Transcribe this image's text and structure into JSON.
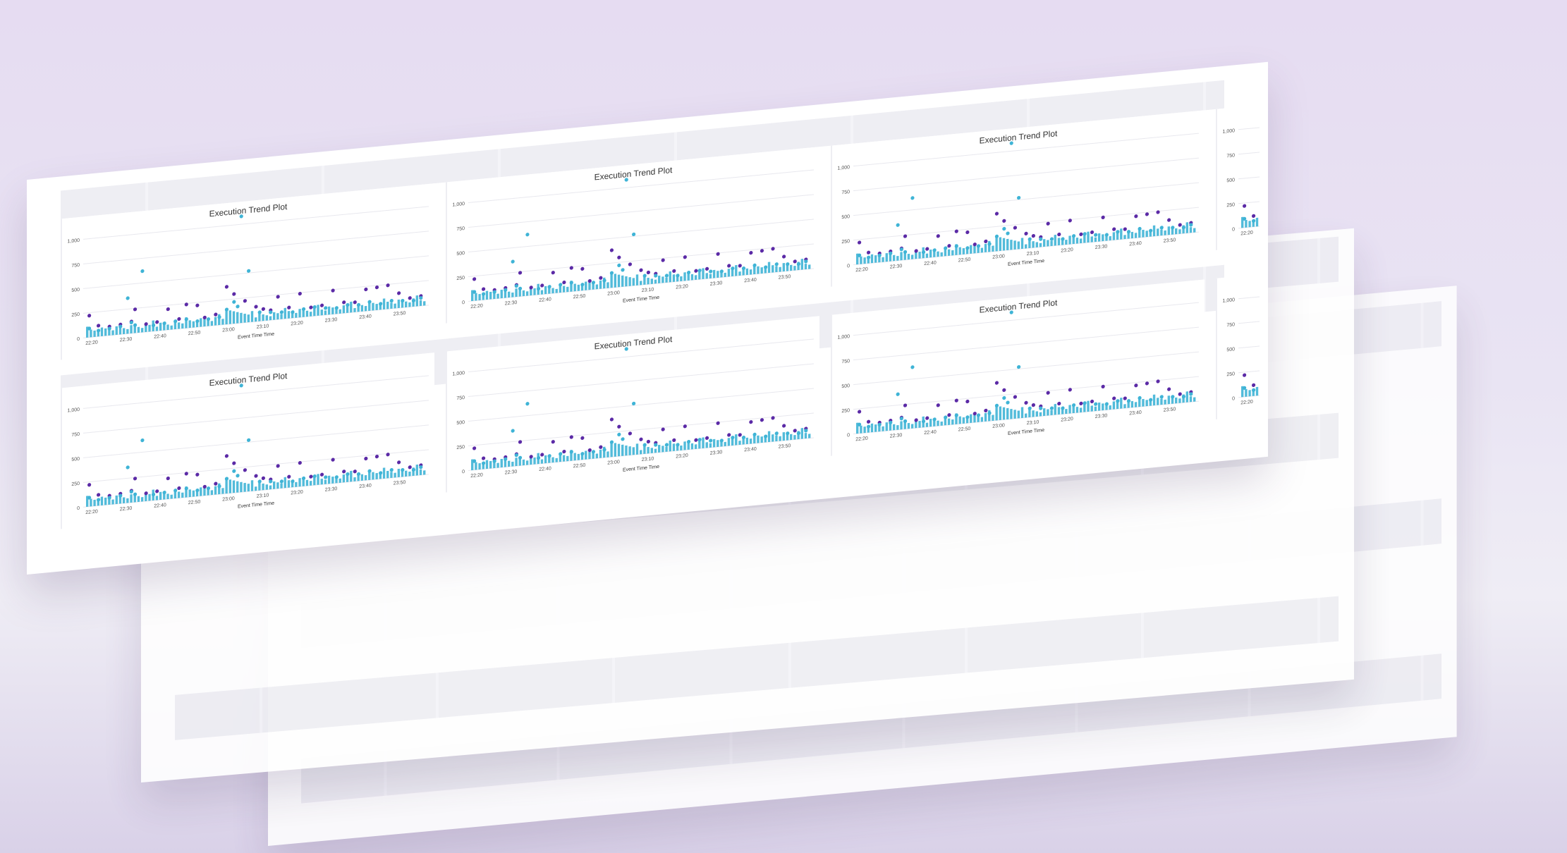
{
  "chart_data": {
    "type": "scatter",
    "title": "Execution Trend Plot",
    "xlabel": "Event Time Time",
    "ylabel": "",
    "x_ticks": [
      "22:20",
      "22:30",
      "22:40",
      "22:50",
      "23:00",
      "23:10",
      "23:20",
      "23:30",
      "23:40",
      "23:50"
    ],
    "y_ticks": [
      "0",
      "250",
      "500",
      "750",
      "1,000"
    ],
    "ylim": [
      0,
      1000
    ],
    "grid": true,
    "series": [
      {
        "color": "#5b2aa6",
        "x": [
          0.5,
          3,
          6,
          9,
          12,
          13,
          16,
          19,
          22,
          25,
          27,
          30,
          32,
          35,
          38,
          40,
          43,
          46,
          48,
          50,
          52,
          55,
          58,
          61,
          64,
          67,
          70,
          73,
          76,
          79,
          82,
          85,
          88,
          91
        ],
        "values": [
          220,
          110,
          90,
          100,
          120,
          240,
          80,
          90,
          210,
          100,
          240,
          220,
          90,
          110,
          380,
          300,
          220,
          150,
          120,
          100,
          230,
          110,
          240,
          90,
          100,
          240,
          110,
          100,
          220,
          230,
          240,
          150,
          90,
          100
        ]
      },
      {
        "color": "#3fb4d6",
        "x": [
          0.5,
          3,
          6,
          9,
          11,
          12,
          13,
          15,
          18,
          21,
          24,
          27,
          30,
          33,
          36,
          38,
          40,
          41,
          42,
          44,
          47,
          50,
          53,
          56,
          59,
          62,
          65,
          68,
          71,
          74,
          77,
          80,
          83,
          86,
          89,
          91
        ],
        "values": [
          90,
          60,
          70,
          80,
          360,
          110,
          80,
          620,
          60,
          70,
          80,
          90,
          60,
          70,
          80,
          150,
          220,
          170,
          1080,
          520,
          90,
          80,
          70,
          60,
          80,
          90,
          70,
          60,
          80,
          70,
          90,
          60,
          80,
          70,
          60,
          80
        ]
      }
    ]
  },
  "colors": {
    "accent_purple": "#5b2aa6",
    "accent_teal": "#3fb4d6",
    "bar_fill": "#3fb4d6"
  }
}
